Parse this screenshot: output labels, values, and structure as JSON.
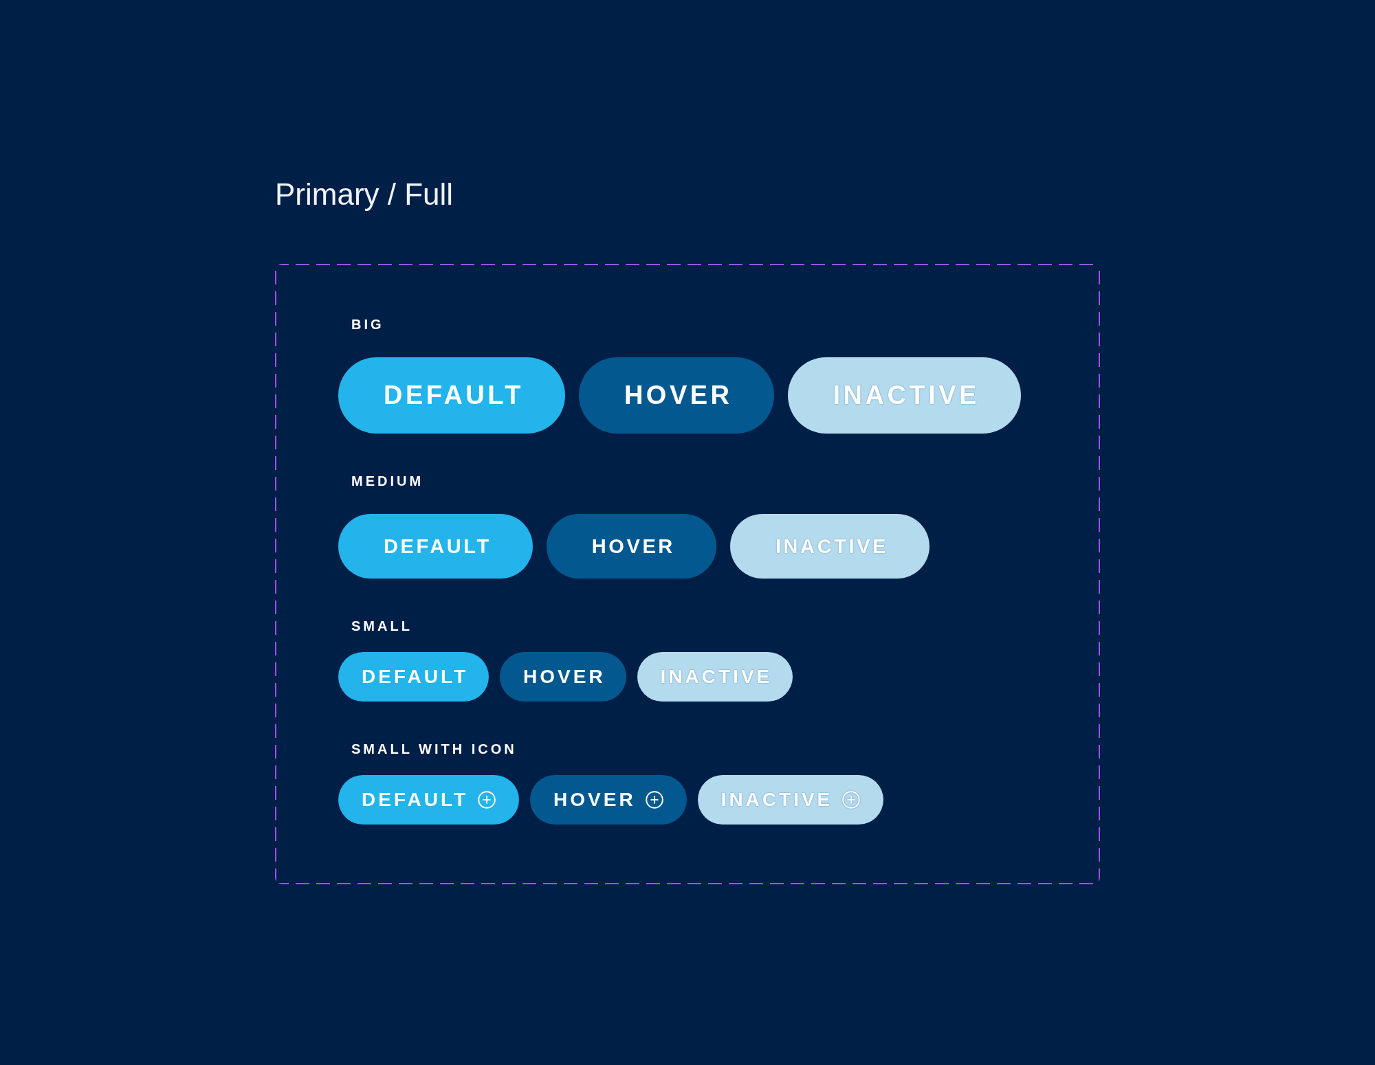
{
  "title": "Primary / Full",
  "sections": [
    {
      "label": "BIG",
      "kind": "big",
      "buttons": [
        {
          "label": "DEFAULT",
          "kind": "default",
          "icon": false
        },
        {
          "label": "HOVER",
          "kind": "hover",
          "icon": false
        },
        {
          "label": "INACTIVE",
          "kind": "inactive",
          "icon": false
        }
      ]
    },
    {
      "label": "MEDIUM",
      "kind": "medium",
      "buttons": [
        {
          "label": "DEFAULT",
          "kind": "default",
          "icon": false
        },
        {
          "label": "HOVER",
          "kind": "hover",
          "icon": false
        },
        {
          "label": "INACTIVE",
          "kind": "inactive",
          "icon": false
        }
      ]
    },
    {
      "label": "SMALL",
      "kind": "small",
      "buttons": [
        {
          "label": "DEFAULT",
          "kind": "default",
          "icon": false
        },
        {
          "label": "HOVER",
          "kind": "hover",
          "icon": false
        },
        {
          "label": "INACTIVE",
          "kind": "inactive",
          "icon": false
        }
      ]
    },
    {
      "label": "SMALL WITH ICON",
      "kind": "small",
      "buttons": [
        {
          "label": "DEFAULT",
          "kind": "default",
          "icon": true
        },
        {
          "label": "HOVER",
          "kind": "hover",
          "icon": true
        },
        {
          "label": "INACTIVE",
          "kind": "inactive",
          "icon": true
        }
      ]
    }
  ]
}
